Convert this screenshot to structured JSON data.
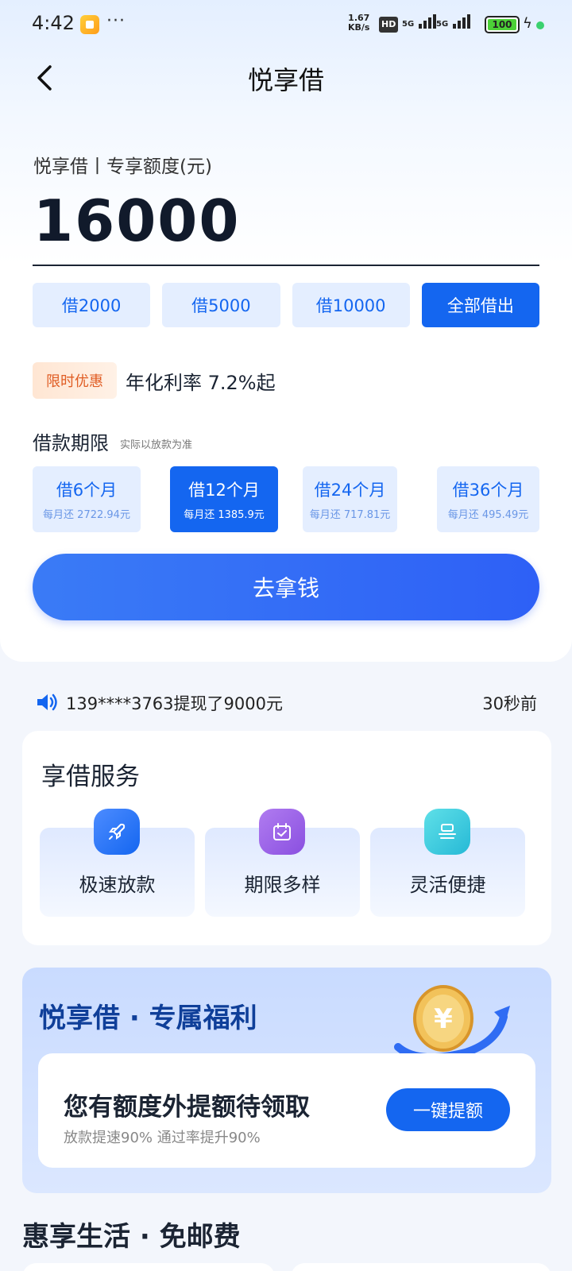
{
  "status_bar": {
    "time": "4:42",
    "more": "···",
    "speed_value": "1.67",
    "speed_unit": "KB/s",
    "hd": "HD",
    "signal1": "5G",
    "signal2": "5G",
    "battery": "100"
  },
  "header": {
    "title": "悦享借"
  },
  "loan": {
    "quota_label": "悦享借丨专享额度(元)",
    "amount": "16000",
    "quick_options": [
      "借2000",
      "借5000",
      "借10000",
      "全部借出"
    ],
    "quick_selected": "全部借出",
    "promo_tag": "限时优惠",
    "rate_text": "年化利率 7.2%起",
    "term_title": "借款期限",
    "term_note": "实际以放款为准",
    "terms": [
      {
        "label": "借6个月",
        "monthly": "每月还 2722.94元"
      },
      {
        "label": "借12个月",
        "monthly": "每月还 1385.9元"
      },
      {
        "label": "借24个月",
        "monthly": "每月还 717.81元"
      },
      {
        "label": "借36个月",
        "monthly": "每月还 495.49元"
      }
    ],
    "term_selected": "借12个月",
    "cta": "去拿钱"
  },
  "ticker": {
    "text": "139****3763提现了9000元",
    "time": "30秒前"
  },
  "services": {
    "title": "享借服务",
    "items": [
      {
        "label": "极速放款",
        "icon": "rocket-icon"
      },
      {
        "label": "期限多样",
        "icon": "calendar-icon"
      },
      {
        "label": "灵活便捷",
        "icon": "stack-icon"
      }
    ]
  },
  "welfare": {
    "title": "悦享借 · 专属福利",
    "card_title": "您有额度外提额待领取",
    "card_sub": "放款提速90% 通过率提升90%",
    "button": "一键提额"
  },
  "life": {
    "title": "惠享生活 · 免邮费"
  },
  "colors": {
    "accent": "#1466f0",
    "promo": "#e05d24",
    "welfare_title": "#0f3f99"
  }
}
